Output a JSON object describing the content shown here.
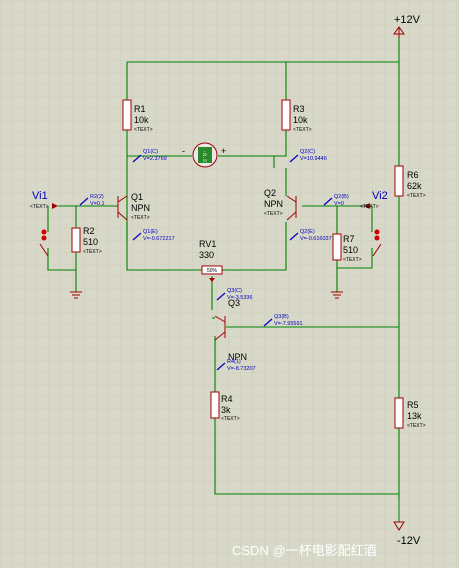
{
  "rails": {
    "pos": "+12V",
    "neg": "-12V"
  },
  "components": {
    "R1": {
      "name": "R1",
      "value": "10k"
    },
    "R3": {
      "name": "R3",
      "value": "10k"
    },
    "R2": {
      "name": "R2",
      "value": "510"
    },
    "R7": {
      "name": "R7",
      "value": "510"
    },
    "R4": {
      "name": "R4",
      "value": "3k"
    },
    "R5": {
      "name": "R5",
      "value": "13k"
    },
    "R6": {
      "name": "R6",
      "value": "62k"
    },
    "RV1": {
      "name": "RV1",
      "value": "330"
    },
    "Q1": {
      "name": "Q1",
      "type": "NPN"
    },
    "Q2": {
      "name": "Q2",
      "type": "NPN"
    },
    "Q3": {
      "name": "Q3",
      "type": "NPN"
    }
  },
  "placeholder_text": "<TEXT>",
  "inputs": {
    "vi1": "Vi1",
    "vi2": "Vi2"
  },
  "probes": {
    "q1c": {
      "id": "Q1(C)",
      "value": "V=2.3769"
    },
    "q2c": {
      "id": "Q2(C)",
      "value": "V=10.9446"
    },
    "q1e": {
      "id": "Q1(E)",
      "value": "V=-0.672217"
    },
    "q2e": {
      "id": "Q2(E)",
      "value": "V=-0.616037"
    },
    "r2": {
      "id": "R2(2)",
      "value": "V=0.1"
    },
    "q2b": {
      "id": "Q2(B)",
      "value": "V=0"
    },
    "q3c": {
      "id": "Q3(C)",
      "value": "V=-3.5336"
    },
    "q3b": {
      "id": "Q3(B)",
      "value": "V=-7.95591"
    },
    "r4": {
      "id": "R4(1)",
      "value": "V=-8.73207"
    }
  },
  "meter": {
    "display": "-8.57",
    "minus": "-",
    "plus": "+"
  },
  "pot_tag": "50%",
  "watermark": "CSDN @一杯电影配红酒"
}
